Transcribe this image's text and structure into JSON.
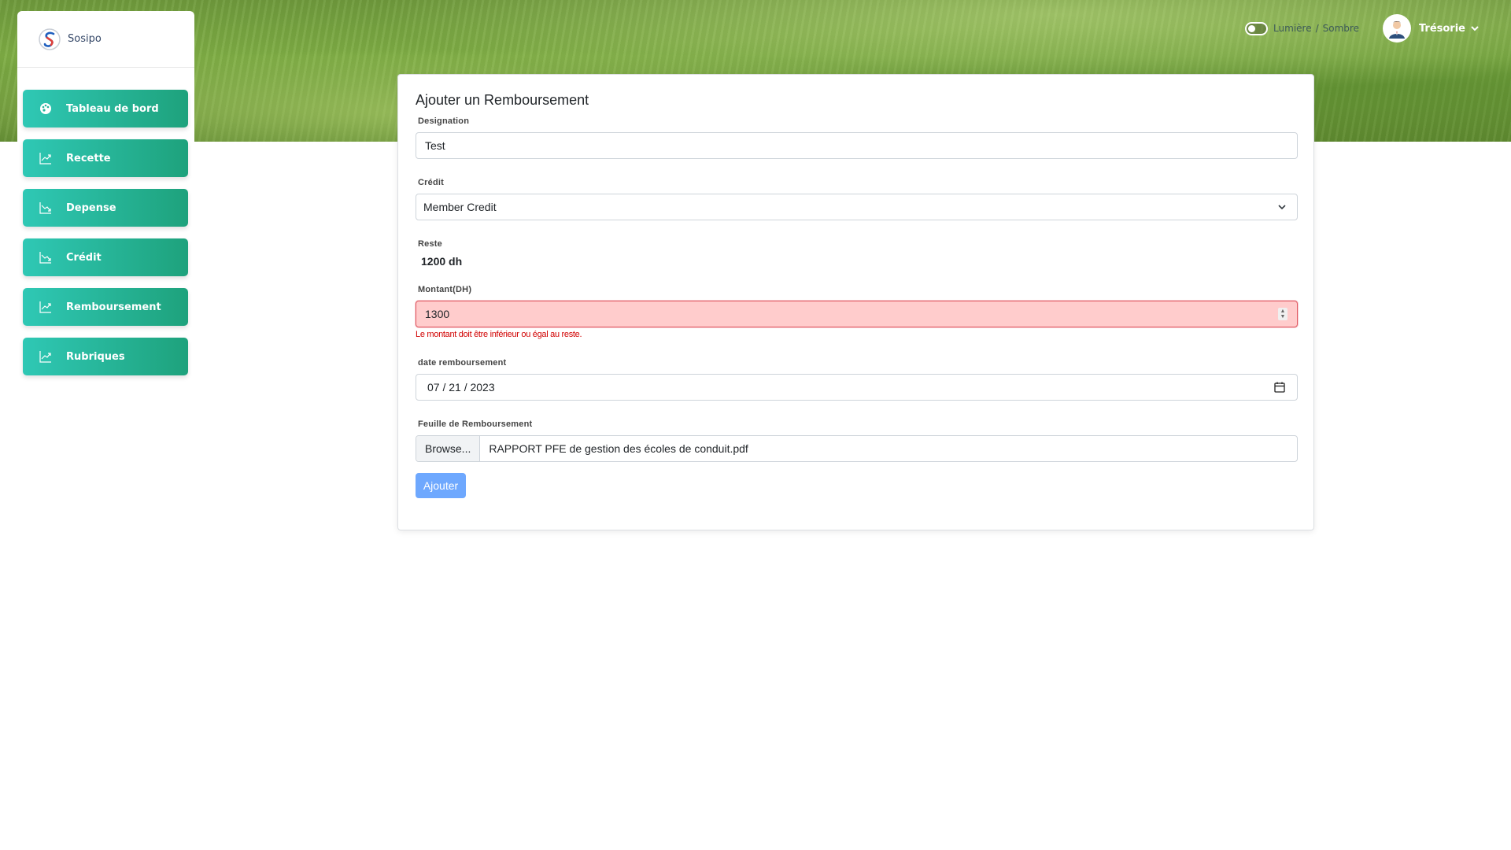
{
  "brand": {
    "name": "Sosipo",
    "logo_icon": "sosipo-logo-icon"
  },
  "sidebar": {
    "items": [
      {
        "label": "Tableau de bord",
        "icon": "palette-icon"
      },
      {
        "label": "Recette",
        "icon": "chart-up-icon"
      },
      {
        "label": "Depense",
        "icon": "chart-down-icon"
      },
      {
        "label": "Crédit",
        "icon": "chart-down-icon"
      },
      {
        "label": "Remboursement",
        "icon": "chart-up-icon"
      },
      {
        "label": "Rubriques",
        "icon": "chart-up-icon"
      }
    ]
  },
  "header": {
    "theme_light": "Lumière",
    "theme_separator": "/",
    "theme_dark": "Sombre",
    "user_name": "Trésorie"
  },
  "form": {
    "title": "Ajouter un Remboursement",
    "designation": {
      "label": "Designation",
      "value": "Test"
    },
    "credit": {
      "label": "Crédit",
      "selected": "Member Credit"
    },
    "reste": {
      "label": "Reste",
      "value": "1200 dh"
    },
    "montant": {
      "label": "Montant(DH)",
      "value": "1300",
      "error": "Le montant doit être inférieur ou égal au reste."
    },
    "date": {
      "label": "date remboursement",
      "value": "07 / 21 / 2023"
    },
    "file": {
      "label": "Feuille de Remboursement",
      "browse": "Browse...",
      "filename": "RAPPORT PFE de gestion des écoles de conduit.pdf"
    },
    "submit": "Ajouter"
  },
  "colors": {
    "nav_gradient_start": "#2fc8b5",
    "nav_gradient_end": "#1ea27c",
    "error_bg": "#ffcccc",
    "error_text": "#d10000",
    "submit_bg": "#6ea8fe"
  }
}
